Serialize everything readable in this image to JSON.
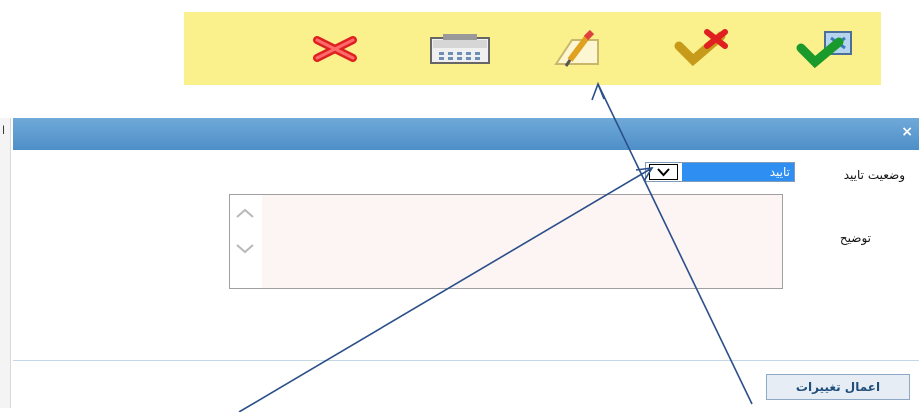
{
  "toolbar": {
    "icons": [
      "delete-icon",
      "calculator-icon",
      "edit-note-icon",
      "reject-icon",
      "approve-icon"
    ]
  },
  "left_panel": {
    "mark": "ا"
  },
  "dialog": {
    "close": "×",
    "status_label": "وضعیت تایید",
    "status_value": "تایید",
    "description_label": "توضیح",
    "description_value": "",
    "apply_button": "اعمال تغییرات"
  },
  "colors": {
    "toolbar_bg": "#faf08c",
    "title_bar": "#5a9ad0",
    "selected_option": "#2f8ef2",
    "arrow": "#2b4f8a"
  }
}
